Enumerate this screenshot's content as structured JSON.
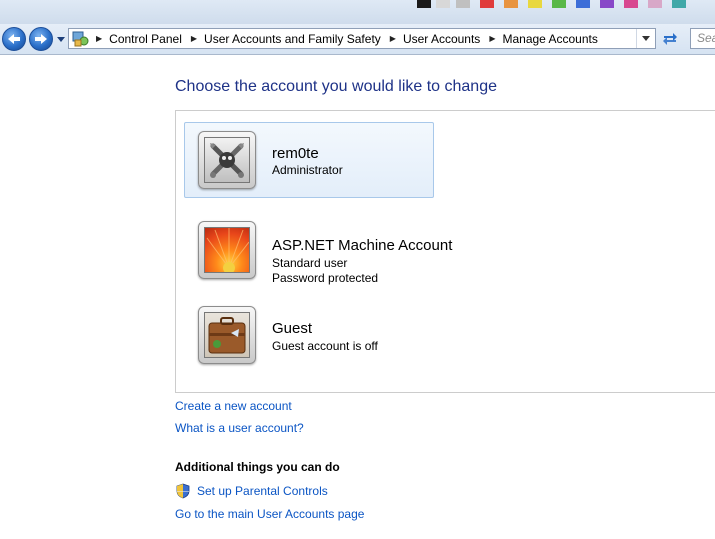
{
  "address_bar": {
    "breadcrumbs": [
      "Control Panel",
      "User Accounts and Family Safety",
      "User Accounts",
      "Manage Accounts"
    ],
    "search_placeholder": "Search"
  },
  "heading": "Choose the account you would like to change",
  "accounts": [
    {
      "name": "rem0te",
      "lines": [
        "Administrator"
      ],
      "picture": "robot-tools-picture",
      "selected": true
    },
    {
      "name": "ASP.NET Machine Account",
      "lines": [
        "Standard user",
        "Password protected"
      ],
      "picture": "orange-flower-picture",
      "selected": false
    },
    {
      "name": "Guest",
      "lines": [
        "Guest account is off"
      ],
      "picture": "suitcase-picture",
      "selected": false
    }
  ],
  "links": {
    "create_account": "Create a new account",
    "what_is_account": "What is a user account?"
  },
  "additional": {
    "heading": "Additional things you can do",
    "parental_controls": "Set up Parental Controls",
    "main_page": "Go to the main User Accounts page"
  },
  "colors": {
    "heading_blue": "#1e3287",
    "link_blue": "#0b55c4",
    "selection_bg": "#e3eefa",
    "selection_border": "#a8c8ea"
  }
}
